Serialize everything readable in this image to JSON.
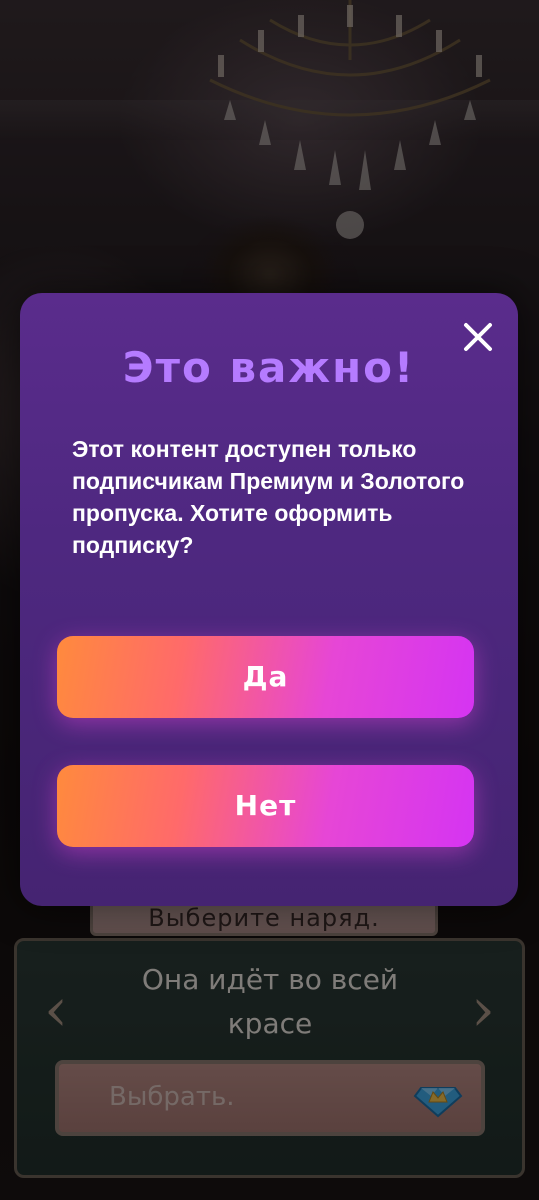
{
  "modal": {
    "title": "Это важно!",
    "message": "Этот контент доступен только подписчикам Премиум и Золотого пропуска. Хотите оформить подписку?",
    "yes_label": "Да",
    "no_label": "Нет",
    "close_icon": "close-icon"
  },
  "choice": {
    "prompt": "Выберите наряд.",
    "option_text": "Она идёт во всей красе",
    "select_label": "Выбрать.",
    "prev_icon": "chevron-left-icon",
    "next_icon": "chevron-right-icon",
    "premium_icon": "diamond-crown-icon"
  },
  "colors": {
    "modal_bg": "#4e2880",
    "title": "#b57bff",
    "button_gradient_start": "#ff8a3d",
    "button_gradient_end": "#d534f2"
  }
}
